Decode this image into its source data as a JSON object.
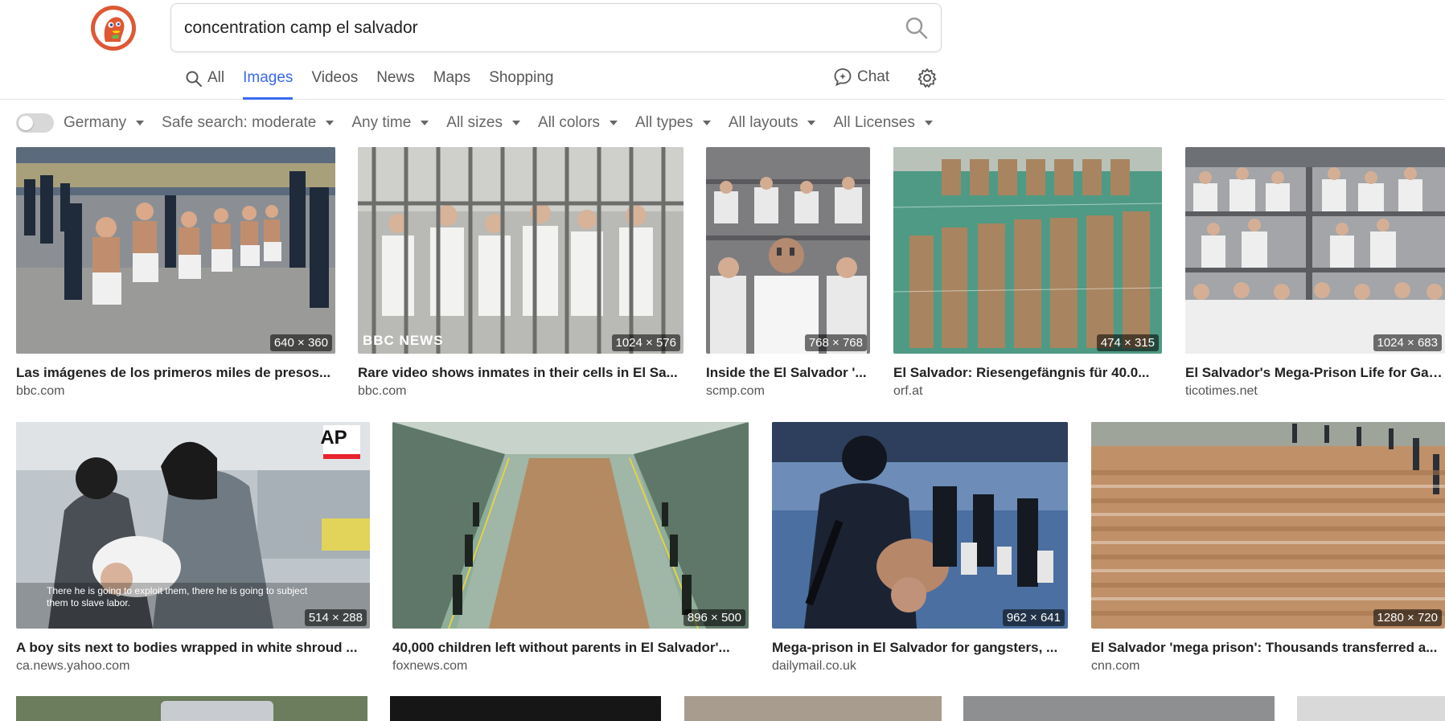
{
  "search": {
    "query": "concentration camp el salvador"
  },
  "tabs": [
    {
      "label": "All",
      "icon": "search-icon"
    },
    {
      "label": "Images"
    },
    {
      "label": "Videos"
    },
    {
      "label": "News"
    },
    {
      "label": "Maps"
    },
    {
      "label": "Shopping"
    }
  ],
  "chat": {
    "label": "Chat",
    "icon": "chat-icon"
  },
  "filters": {
    "region": "Germany",
    "safe_search": "Safe search: moderate",
    "time": "Any time",
    "size": "All sizes",
    "color": "All colors",
    "type": "All types",
    "layout": "All layouts",
    "license": "All Licenses"
  },
  "colors": {
    "accent": "#3969ef",
    "logo": "#de5833"
  },
  "results": [
    {
      "title": "Las imágenes de los primeros miles de presos...",
      "source": "bbc.com",
      "dims": "640 × 360",
      "img": "officers-escorting-prisoners"
    },
    {
      "title": "Rare video shows inmates in their cells in El Sa...",
      "source": "bbc.com",
      "dims": "1024 × 576",
      "img": "inmates-behind-bars",
      "watermark": "BBC NEWS"
    },
    {
      "title": "Inside the El Salvador '...",
      "source": "scmp.com",
      "dims": "768 × 768",
      "img": "inmates-in-bunks"
    },
    {
      "title": "El Salvador: Riesengefängnis für 40.0...",
      "source": "orf.at",
      "dims": "474 × 315",
      "img": "aerial-rows-of-prisoners"
    },
    {
      "title": "El Salvador's Mega-Prison Life for Gan...",
      "source": "ticotimes.net",
      "dims": "1024 × 683",
      "img": "crowded-cell-bunks"
    },
    {
      "title": "A boy sits next to bodies wrapped in white shroud ...",
      "source": "ca.news.yahoo.com",
      "dims": "514 × 288",
      "img": "officers-restraining-man",
      "watermark": "AP",
      "caption": "There he is going to exploit them, there he is going to subject them to slave labor."
    },
    {
      "title": "40,000 children left without parents in El Salvador'...",
      "source": "foxnews.com",
      "dims": "896 × 500",
      "img": "hall-of-seated-prisoners"
    },
    {
      "title": "Mega-prison in El Salvador for gangsters, ...",
      "source": "dailymail.co.uk",
      "dims": "962 × 641",
      "img": "armed-guards-with-prisoners"
    },
    {
      "title": "El Salvador 'mega prison': Thousands transferred a...",
      "source": "cnn.com",
      "dims": "1280 × 720",
      "img": "prisoners-on-floor"
    }
  ]
}
